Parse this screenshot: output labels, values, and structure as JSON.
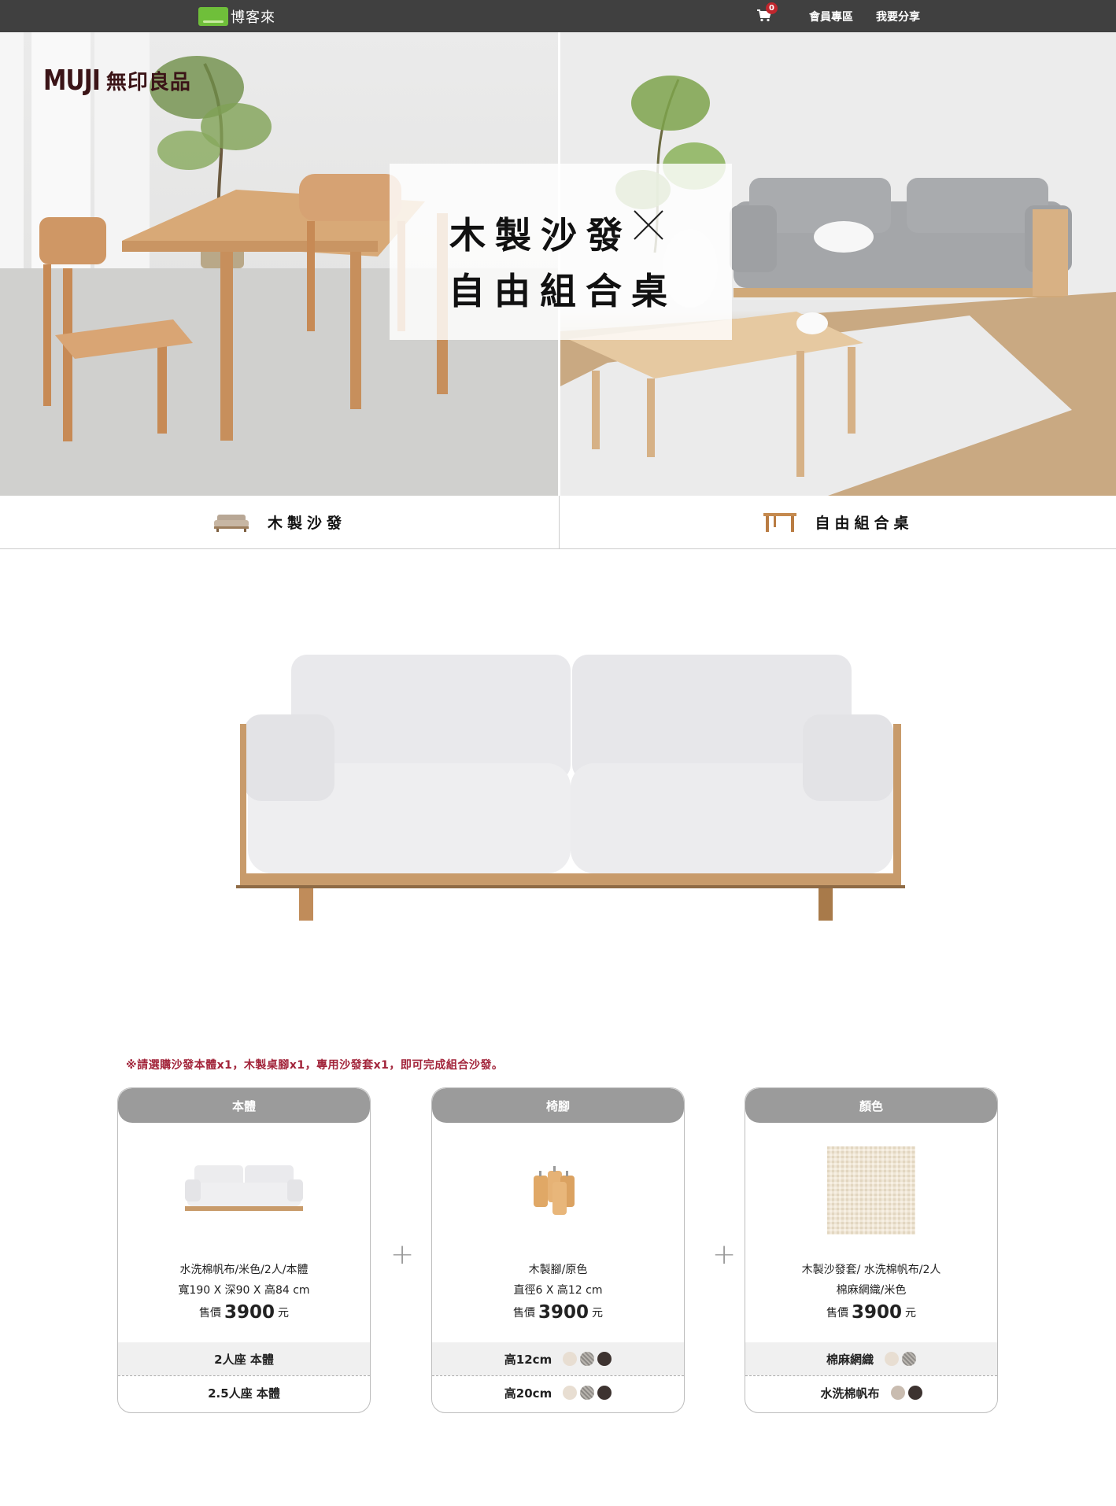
{
  "topbar": {
    "brand": "博客來",
    "cart_count": "0",
    "links": [
      "會員專區",
      "我要分享"
    ]
  },
  "hero": {
    "logo_en": "MUJI",
    "logo_zh": "無印良品",
    "title_line1": "木製沙發",
    "title_line2": "自由組合桌"
  },
  "tabs": [
    {
      "label": "木製沙發",
      "icon": "sofa-icon"
    },
    {
      "label": "自由組合桌",
      "icon": "table-icon"
    }
  ],
  "notice": "※請選購沙發本體x1，木製桌腳x1，專用沙發套x1，即可完成組合沙發。",
  "cards": [
    {
      "header": "本體",
      "desc_line1": "水洗棉帆布/米色/2人/本體",
      "desc_line2": "寬190 X 深90 X 高84 cm",
      "price_label": "售價",
      "price": "3900",
      "price_unit": "元",
      "options": [
        "2人座 本體",
        "2.5人座 本體"
      ]
    },
    {
      "header": "椅腳",
      "desc_line1": "木製腳/原色",
      "desc_line2": "直徑6 X 高12 cm",
      "price_label": "售價",
      "price": "3900",
      "price_unit": "元",
      "options": [
        "高12cm",
        "高20cm"
      ]
    },
    {
      "header": "顏色",
      "desc_line1": "木製沙發套/ 水洗棉帆布/2人",
      "desc_line2": "棉麻網織/米色",
      "price_label": "售價",
      "price": "3900",
      "price_unit": "元",
      "options": [
        "棉麻網織",
        "水洗棉帆布"
      ]
    }
  ],
  "colors": {
    "topbar": "#404040",
    "notice": "#a2243a",
    "card_header": "#9b9b9b",
    "badge": "#c0262d"
  }
}
